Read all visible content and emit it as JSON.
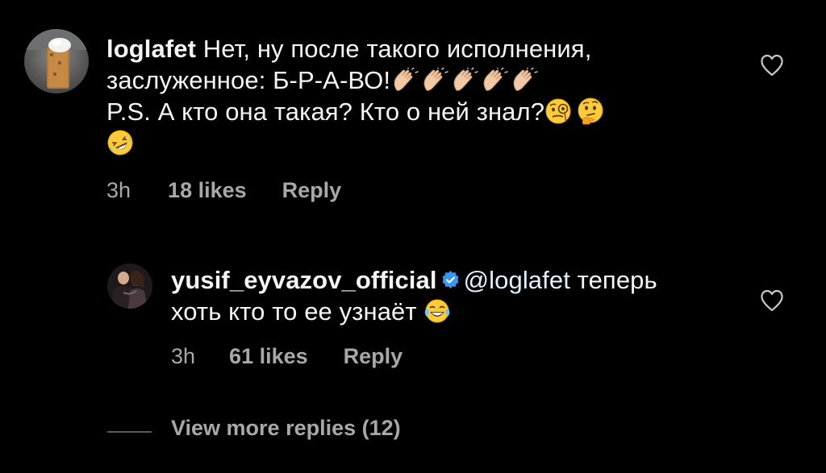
{
  "comment": {
    "username": "loglafet",
    "line1_text": "Нет, ну после такого исполнения,",
    "line2_text": "заслуженное: Б-Р-А-ВО!",
    "line3_text": "P.S. А кто она такая? Кто о ней знал?",
    "time": "3h",
    "likes": "18 likes",
    "reply_label": "Reply",
    "icons": {
      "avatar": "avatar",
      "like": "heart-outline-icon",
      "claps": "clapping-hands-emoji",
      "monocle": "face-with-monocle-emoji",
      "thinking": "thinking-face-emoji",
      "rolling": "rolling-on-floor-laughing-emoji"
    }
  },
  "reply": {
    "username": "yusif_eyvazov_official",
    "mention": "@loglafet",
    "line1_text": "теперь",
    "line2_text": "хоть кто то ее узнаёт",
    "time": "3h",
    "likes": "61 likes",
    "reply_label": "Reply",
    "icons": {
      "verified": "verified-badge-icon",
      "laugh": "face-with-tears-of-joy-emoji",
      "like": "heart-outline-icon"
    }
  },
  "view_more": "View more replies (12)",
  "colors": {
    "background": "#000000",
    "text": "#f5f5f5",
    "secondary": "#a8a8a8",
    "verified": "#3897f0",
    "mention": "#e0f1ff"
  }
}
